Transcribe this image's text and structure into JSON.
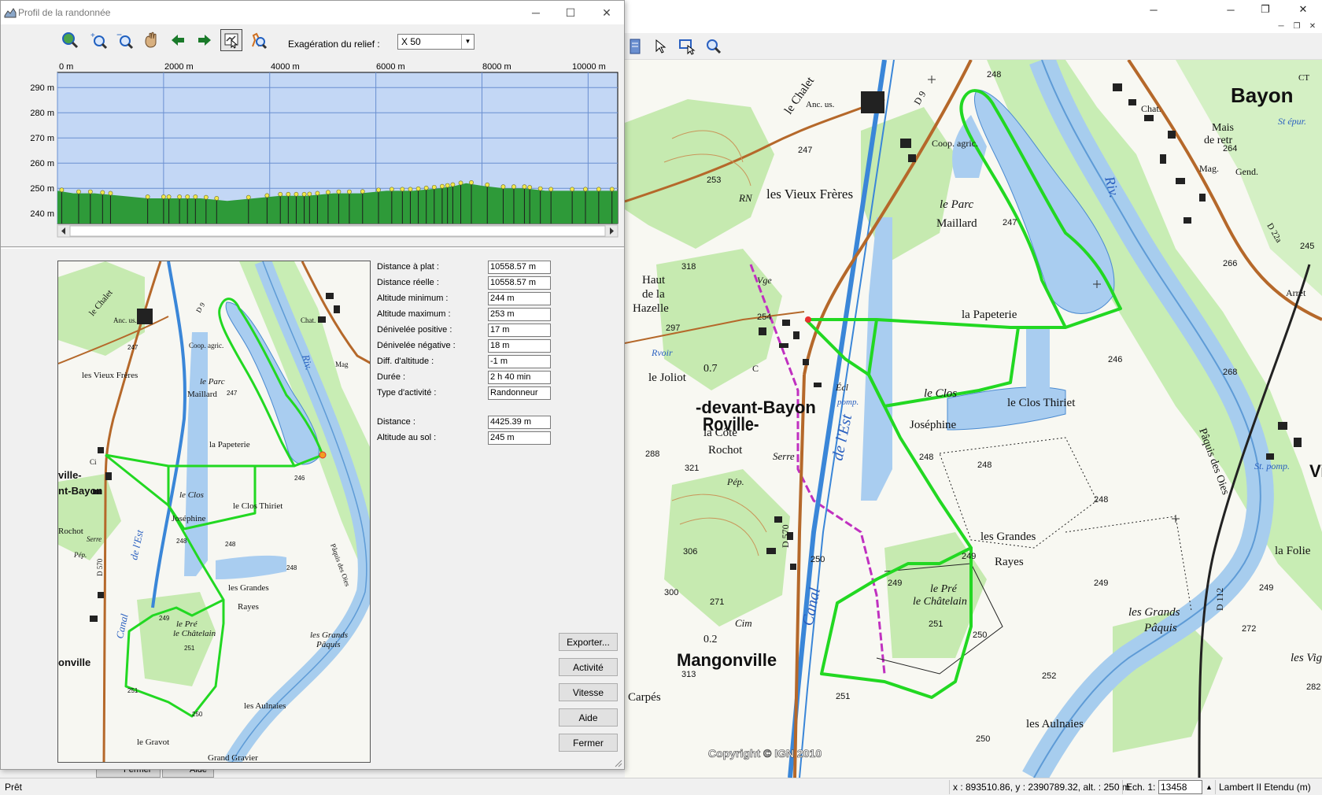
{
  "dialog": {
    "title": "Profil de la randonnée",
    "relief_label": "Exagération du relief :",
    "relief_value": "X 50",
    "x_ticks": [
      "0 m",
      "2000 m",
      "4000 m",
      "6000 m",
      "8000 m",
      "10000 m"
    ],
    "y_ticks": [
      "290 m",
      "280 m",
      "270 m",
      "260 m",
      "250 m",
      "240 m"
    ],
    "stats": [
      {
        "label": "Distance à plat :",
        "value": "10558.57 m"
      },
      {
        "label": "Distance réelle :",
        "value": "10558.57 m"
      },
      {
        "label": "Altitude minimum :",
        "value": "244 m"
      },
      {
        "label": "Altitude maximum :",
        "value": "253 m"
      },
      {
        "label": "Dénivelée positive :",
        "value": "17 m"
      },
      {
        "label": "Dénivelée négative :",
        "value": "18 m"
      },
      {
        "label": "Diff. d'altitude :",
        "value": "-1 m"
      },
      {
        "label": "Durée :",
        "value": "2 h 40 min"
      },
      {
        "label": "Type d'activité :",
        "value": "Randonneur"
      }
    ],
    "extra_stats": [
      {
        "label": "Distance :",
        "value": "4425.39 m"
      },
      {
        "label": "Altitude au sol :",
        "value": "245 m"
      }
    ],
    "buttons": {
      "export": "Exporter...",
      "activity": "Activité",
      "speed": "Vitesse",
      "help": "Aide",
      "close": "Fermer"
    }
  },
  "mini_map_labels": {
    "chalet": "le Chalet",
    "vieux": "les Vieux Frères",
    "coop": "Coop. agric.",
    "anc": "Anc. us.",
    "parc": "le Parc",
    "maillard": "Maillard",
    "papeterie": "la Papeterie",
    "clos": "le Clos",
    "josephine": "Joséphine",
    "thiriet": "le Clos Thiriet",
    "grandes": "les Grandes",
    "rayes": "Rayes",
    "pre": "le Pré",
    "chatelain": "le Châtelain",
    "paquis": "Pâquis",
    "grands": "les Grands",
    "aulnaies": "les Aulnaies",
    "gravot": "le Gravot",
    "roville": "ville-",
    "bayon": "nt-Bayon",
    "rochot": "Rochot",
    "serre": "Serre",
    "pep": "Pép.",
    "canal": "Canal",
    "est": "de l'Est",
    "riv": "Riv.",
    "paquis_des_oies": "Pâquis des Oies",
    "chat": "Chat.",
    "mag": "Mag",
    "mangonville": "onville",
    "grand_gravier": "Grand Gravier",
    "d570": "D 570",
    "d9": "D 9",
    "ci": "Ci",
    "e246": "246",
    "e248": "248",
    "e249": "249",
    "e250": "250",
    "e251": "251",
    "e247": "247"
  },
  "main_map_labels": {
    "chalet": "le Chalet",
    "anc": "Anc. us.",
    "coop": "Coop. agric.",
    "vieux": "les Vieux Frères",
    "rn": "RN",
    "parc": "le Parc",
    "maillard": "Maillard",
    "haut": "Haut",
    "de_la": "de la",
    "hazelle": "Hazelle",
    "vge": "Vge",
    "joliot": "le Joliot",
    "rvoir": "Rvoir",
    "roville": "Roville-",
    "devant": "-devant-Bayon",
    "la_cote": "la Côte",
    "rochot": "Rochot",
    "serre": "Serre",
    "pep": "Pép.",
    "papeterie": "la Papeterie",
    "clos": "le Clos",
    "josephine": "Joséphine",
    "thiriet": "le Clos Thiriet",
    "grandes": "les Grandes",
    "rayes": "Rayes",
    "pre": "le Pré",
    "chatelain": "le Châtelain",
    "grands": "les Grands",
    "paquis": "Pâquis",
    "aulnaies": "les Aulnaies",
    "mangonville": "Mangonville",
    "carpes": "Carpés",
    "bayon": "Bayon",
    "mais": "Mais",
    "de_retr": "de retr",
    "gend": "Gend.",
    "mag": "Mag.",
    "chat": "Chat.",
    "st_epur": "St épur.",
    "arret": "Arrêt",
    "la_folie": "la Folie",
    "les_vig": "les Vig",
    "paquis_des_oies": "Pâquis des Oies",
    "riv": "Riv.",
    "canal": "Canal",
    "est": "de l'Est",
    "d570": "D 570",
    "d112": "D 112",
    "d9": "D 9",
    "d22a": "D 22a",
    "st_pomp": "St. pomp.",
    "cim": "Cim",
    "ct": "CT",
    "vi": "Vi",
    "ecl": "Écl",
    "pomp": "pomp.",
    "e253": "253",
    "e254": "254",
    "e247": "247",
    "e248": "248",
    "e246": "246",
    "e249": "249",
    "e250": "250",
    "e251": "251",
    "e252": "252",
    "e318": "318",
    "e297": "297",
    "e288": "288",
    "e321": "321",
    "e306": "306",
    "e300": "300",
    "e271": "271",
    "e313": "313",
    "e282": "282",
    "e264": "264",
    "e266": "266",
    "e268": "268",
    "e272": "272",
    "e245": "245",
    "p07": "0.7",
    "p02": "0.2",
    "c": "C",
    "copyright": "Copyright © IGN 2010"
  },
  "statusbar": {
    "status": "Prêt",
    "coords": "x : 893510.86, y : 2390789.32, alt. : 250 m",
    "scale_label": "Ech. 1:",
    "scale_value": "13458",
    "projection": "Lambert II Etendu (m)"
  },
  "background_buttons": {
    "fermer": "Fermer",
    "aide": "Aide"
  },
  "colors": {
    "sky": "#c3d7f5",
    "ground": "#2e9a39",
    "route": "#2ee02e",
    "water": "#a9cdf0",
    "forest": "#bfe9a5"
  },
  "chart_data": {
    "type": "area",
    "title": "",
    "xlabel": "",
    "ylabel": "",
    "xlim": [
      0,
      10558
    ],
    "ylim": [
      236,
      296
    ],
    "x": [
      0,
      300,
      700,
      1200,
      1700,
      2200,
      2700,
      3200,
      3700,
      4200,
      4700,
      5200,
      5700,
      6200,
      6700,
      7200,
      7500,
      7700,
      8000,
      8400,
      8800,
      9200,
      9600,
      10000,
      10558
    ],
    "values": [
      249,
      248,
      248,
      247,
      246,
      246,
      246,
      245,
      246,
      247,
      247,
      248,
      248,
      249,
      249,
      250,
      251,
      252,
      251,
      250,
      250,
      249,
      249,
      249,
      249
    ],
    "markers_x": [
      80,
      400,
      620,
      850,
      1000,
      1700,
      2000,
      2100,
      2300,
      2450,
      2600,
      2800,
      3000,
      3600,
      3950,
      4200,
      4350,
      4500,
      4650,
      4750,
      4900,
      5100,
      5300,
      5500,
      5750,
      6050,
      6300,
      6500,
      6650,
      6800,
      6950,
      7100,
      7250,
      7350,
      7450,
      7600,
      7800,
      8100,
      8400,
      8600,
      8800,
      8900,
      9100,
      9300,
      9700,
      9950,
      10200,
      10450
    ]
  }
}
